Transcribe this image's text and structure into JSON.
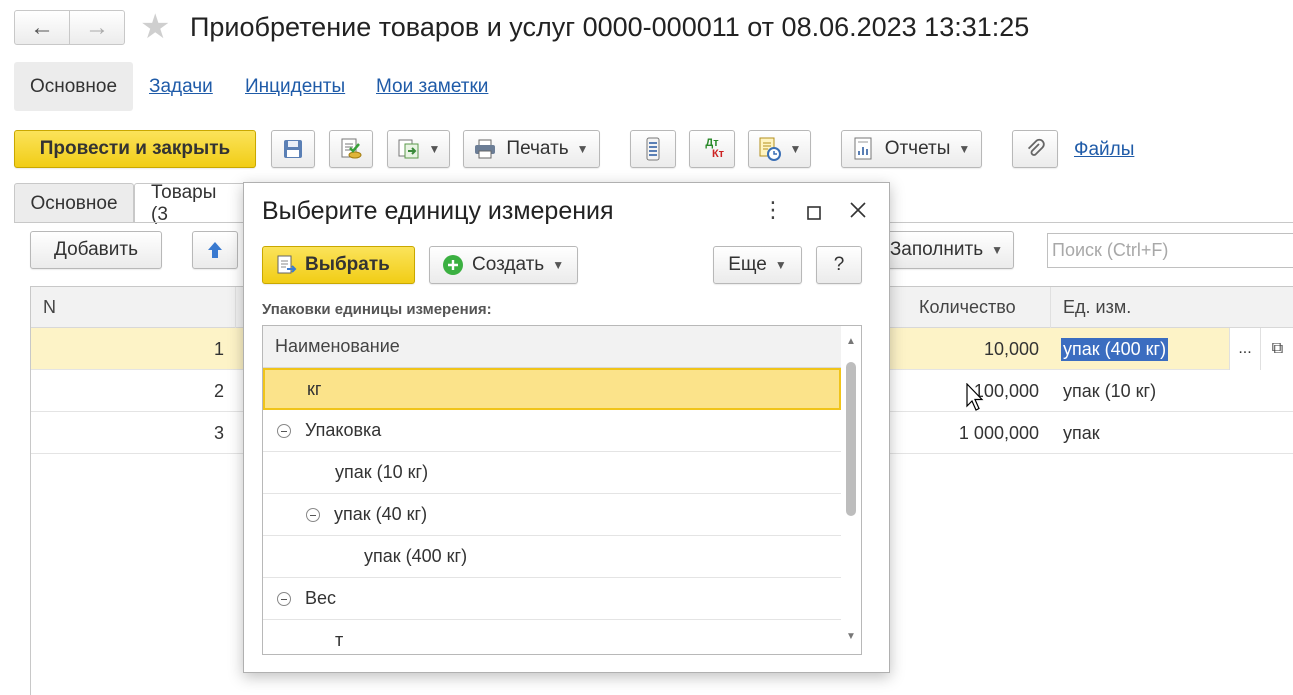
{
  "window": {
    "back_icon": "←",
    "forward_icon": "→",
    "title": "Приобретение товаров и услуг 0000-000011 от 08.06.2023 13:31:25"
  },
  "sections": {
    "active": "Основное",
    "links": [
      "Задачи",
      "Инциденты",
      "Мои заметки"
    ]
  },
  "toolbar": {
    "post_close": "Провести и закрыть",
    "print": "Печать",
    "reports": "Отчеты",
    "files": "Файлы",
    "dt_kt": "Дт Кт"
  },
  "form_tabs": {
    "main": "Основное",
    "goods": "Товары (3"
  },
  "goods_toolbar": {
    "add": "Добавить",
    "fill": "Заполнить",
    "search_placeholder": "Поиск (Ctrl+F)"
  },
  "grid": {
    "col_n": "N",
    "col_qty": "Количество",
    "col_unit": "Ед. изм.",
    "rows": [
      {
        "n": "1",
        "qty": "10,000",
        "unit": "упак (400 кг)"
      },
      {
        "n": "2",
        "qty": "100,000",
        "unit": "упак (10 кг)"
      },
      {
        "n": "3",
        "qty": "1 000,000",
        "unit": "упак"
      }
    ],
    "edit_more": "...",
    "open_icon": "⧉"
  },
  "dialog": {
    "title": "Выберите единицу измерения",
    "select": "Выбрать",
    "create": "Создать",
    "more": "Еще",
    "help": "?",
    "list_label": "Упаковки единицы измерения:",
    "list_header": "Наименование",
    "items": [
      {
        "label": "кг",
        "level": 1,
        "group": false
      },
      {
        "label": "Упаковка",
        "level": 0,
        "group": true
      },
      {
        "label": "упак (10 кг)",
        "level": 2,
        "group": false
      },
      {
        "label": "упак (40 кг)",
        "level": 1,
        "group": true
      },
      {
        "label": "упак (400 кг)",
        "level": 3,
        "group": false
      },
      {
        "label": "Вес",
        "level": 0,
        "group": true
      },
      {
        "label": "т",
        "level": 2,
        "group": false
      }
    ]
  }
}
